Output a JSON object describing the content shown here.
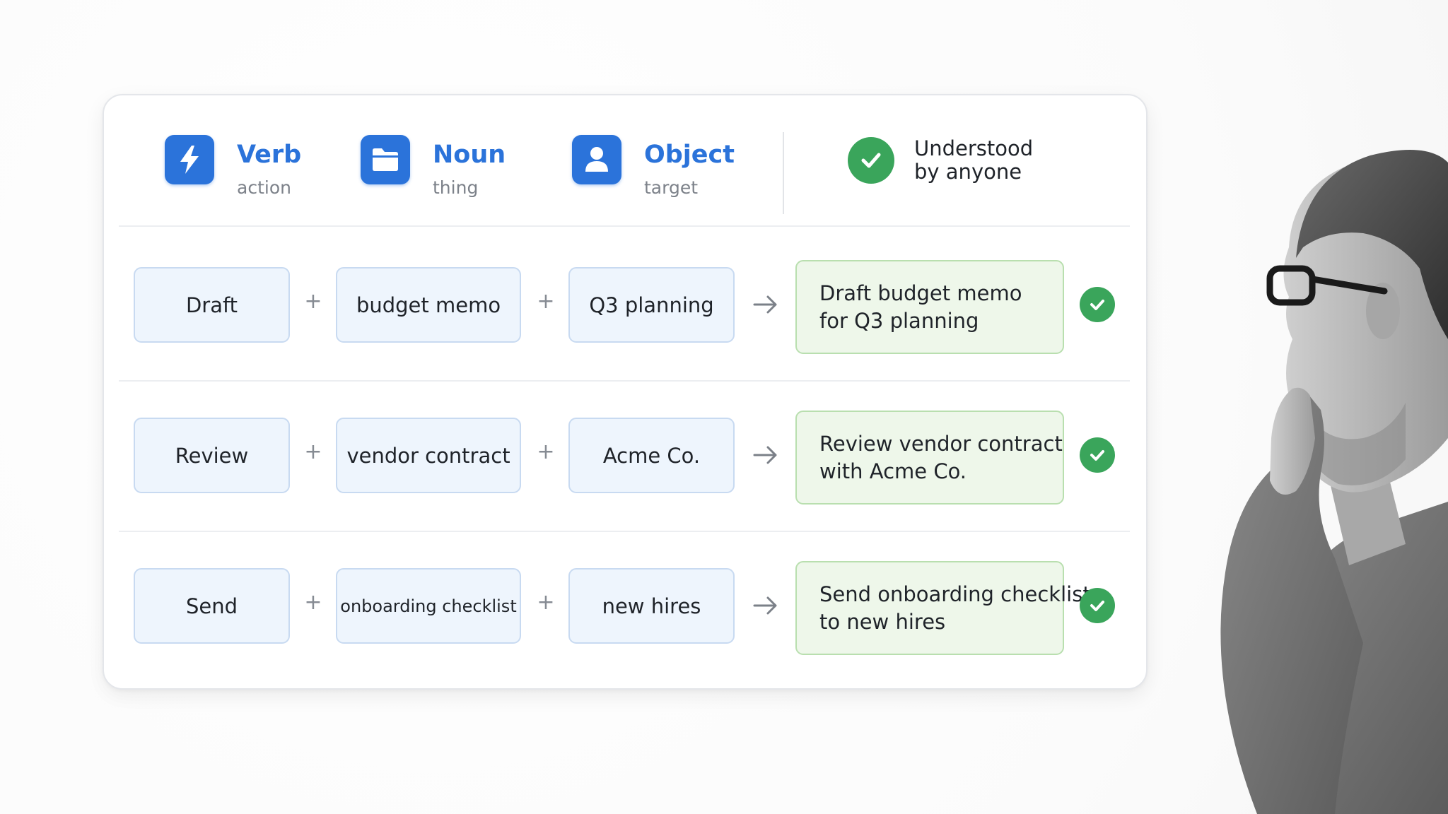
{
  "legend": {
    "verb": {
      "title": "Verb",
      "subtitle": "action",
      "icon": "lightning-icon"
    },
    "noun": {
      "title": "Noun",
      "subtitle": "thing",
      "icon": "folder-icon"
    },
    "object": {
      "title": "Object",
      "subtitle": "target",
      "icon": "person-icon"
    },
    "understood": {
      "line1": "Understood",
      "line2": "by anyone",
      "icon": "check-circle-icon"
    }
  },
  "rows": [
    {
      "verb": "Draft",
      "noun": "budget memo",
      "object": "Q3 planning",
      "result_line1": "Draft budget memo",
      "result_line2": "for Q3 planning"
    },
    {
      "verb": "Review",
      "noun": "vendor contract",
      "object": "Acme Co.",
      "result_line1": "Review vendor contract",
      "result_line2": "with Acme Co."
    },
    {
      "verb": "Send",
      "noun": "onboarding checklist",
      "object": "new hires",
      "result_line1": "Send onboarding checklist",
      "result_line2": "to new hires"
    }
  ],
  "symbols": {
    "plus": "+"
  },
  "colors": {
    "accent_blue": "#2b73da",
    "chip_bg": "#eef5fd",
    "chip_border": "#c8daf1",
    "result_bg": "#eef7ea",
    "result_border": "#b9dfaf",
    "check_green": "#3aa55b"
  }
}
